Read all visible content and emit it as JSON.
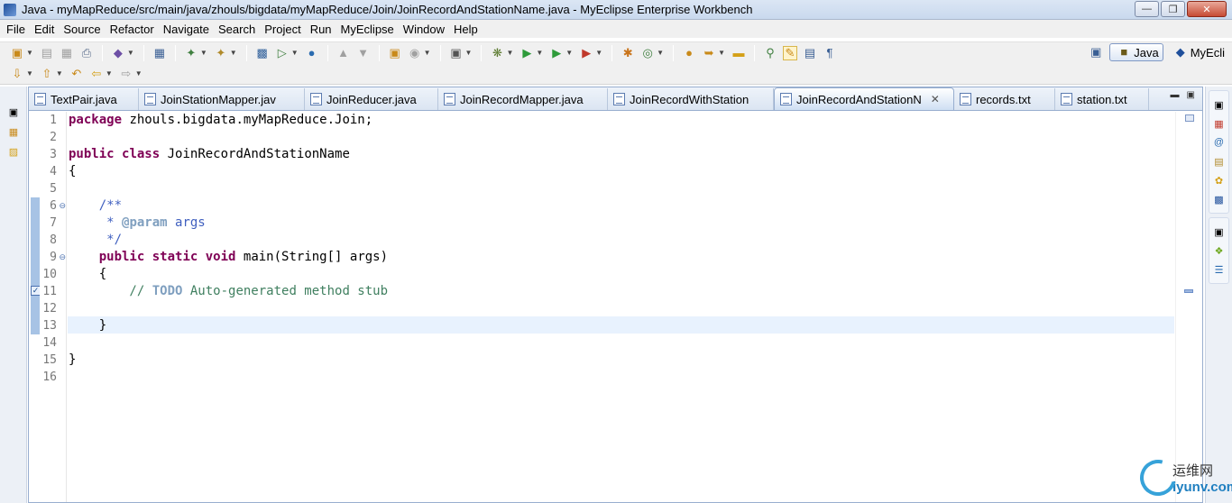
{
  "window": {
    "title": "Java - myMapReduce/src/main/java/zhouls/bigdata/myMapReduce/Join/JoinRecordAndStationName.java - MyEclipse Enterprise Workbench",
    "minimize": "—",
    "maximize": "❐",
    "close": "✕"
  },
  "menu": [
    "File",
    "Edit",
    "Source",
    "Refactor",
    "Navigate",
    "Search",
    "Project",
    "Run",
    "MyEclipse",
    "Window",
    "Help"
  ],
  "perspectives": {
    "java": "Java",
    "myeclipse": "MyEcli"
  },
  "tabs": [
    {
      "label": "TextPair.java"
    },
    {
      "label": "JoinStationMapper.jav"
    },
    {
      "label": "JoinReducer.java"
    },
    {
      "label": "JoinRecordMapper.java"
    },
    {
      "label": "JoinRecordWithStation"
    },
    {
      "label": "JoinRecordAndStationN",
      "close": "✕"
    },
    {
      "label": "records.txt"
    },
    {
      "label": "station.txt"
    }
  ],
  "code": {
    "line_numbers": [
      "1",
      "2",
      "3",
      "4",
      "5",
      "6",
      "7",
      "8",
      "9",
      "10",
      "11",
      "12",
      "13",
      "14",
      "15",
      "16"
    ],
    "l1_kw": "package",
    "l1_rest": " zhouls.bigdata.myMapReduce.Join;",
    "l3_kw1": "public",
    "l3_kw2": "class",
    "l3_rest": " JoinRecordAndStationName",
    "l4": "{",
    "l6": "    /**",
    "l7_pre": "     * ",
    "l7_tag": "@param",
    "l7_rest": " args",
    "l8": "     */",
    "l9_indent": "    ",
    "l9_kw1": "public",
    "l9_kw2": "static",
    "l9_kw3": "void",
    "l9_rest": " main(String[] args)",
    "l10": "    {",
    "l11_pre": "        // ",
    "l11_todo": "TODO",
    "l11_rest": " Auto-generated method stub",
    "l13": "    }",
    "l15": "}"
  },
  "watermark": {
    "cn": "运维网",
    "en": "iyunv.com"
  }
}
